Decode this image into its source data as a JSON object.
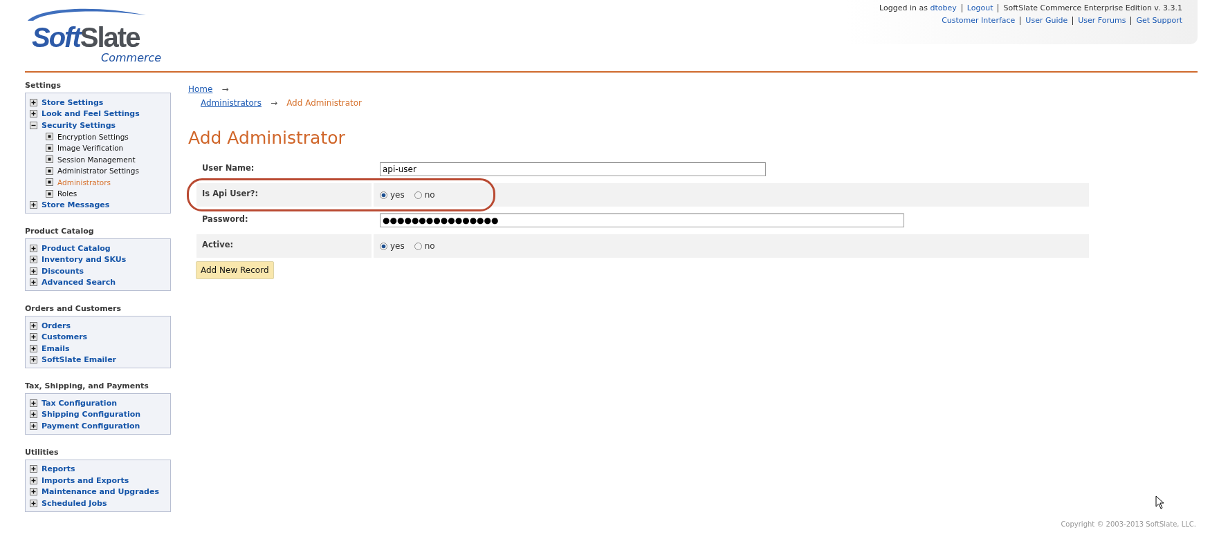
{
  "logo": {
    "wordmark": "**Soft**Slate",
    "tagline": "Commerce"
  },
  "header": {
    "login_prefix": "Logged in as",
    "user": "dtobey",
    "logout": "Logout",
    "edition": "SoftSlate Commerce Enterprise Edition v. 3.3.1",
    "links": [
      "Customer Interface",
      "User Guide",
      "User Forums",
      "Get Support"
    ]
  },
  "sidebar": [
    {
      "heading": "Settings",
      "items": [
        {
          "label": "Store Settings",
          "expanded": false
        },
        {
          "label": "Look and Feel Settings",
          "expanded": false
        },
        {
          "label": "Security Settings",
          "expanded": true,
          "children": [
            {
              "label": "Encryption Settings",
              "selected": false
            },
            {
              "label": "Image Verification",
              "selected": false
            },
            {
              "label": "Session Management",
              "selected": false
            },
            {
              "label": "Administrator Settings",
              "selected": false
            },
            {
              "label": "Administrators",
              "selected": true
            },
            {
              "label": "Roles",
              "selected": false
            }
          ]
        },
        {
          "label": "Store Messages",
          "expanded": false
        }
      ]
    },
    {
      "heading": "Product Catalog",
      "items": [
        {
          "label": "Product Catalog",
          "expanded": false
        },
        {
          "label": "Inventory and SKUs",
          "expanded": false
        },
        {
          "label": "Discounts",
          "expanded": false
        },
        {
          "label": "Advanced Search",
          "expanded": false
        }
      ]
    },
    {
      "heading": "Orders and Customers",
      "items": [
        {
          "label": "Orders",
          "expanded": false
        },
        {
          "label": "Customers",
          "expanded": false
        },
        {
          "label": "Emails",
          "expanded": false
        },
        {
          "label": "SoftSlate Emailer",
          "expanded": false
        }
      ]
    },
    {
      "heading": "Tax, Shipping, and Payments",
      "items": [
        {
          "label": "Tax Configuration",
          "expanded": false
        },
        {
          "label": "Shipping Configuration",
          "expanded": false
        },
        {
          "label": "Payment Configuration",
          "expanded": false
        }
      ]
    },
    {
      "heading": "Utilities",
      "items": [
        {
          "label": "Reports",
          "expanded": false
        },
        {
          "label": "Imports and Exports",
          "expanded": false
        },
        {
          "label": "Maintenance and Upgrades",
          "expanded": false
        },
        {
          "label": "Scheduled Jobs",
          "expanded": false
        }
      ]
    }
  ],
  "breadcrumb": {
    "separator": "→",
    "items": [
      {
        "label": "Home",
        "kind": "link"
      },
      {
        "label": "Administrators",
        "kind": "link"
      },
      {
        "label": "Add Administrator",
        "kind": "current"
      }
    ]
  },
  "title": "Add Administrator",
  "form": {
    "fields": [
      {
        "label": "User Name:",
        "kind": "text",
        "value": "api-user",
        "highlighted": false
      },
      {
        "label": "Is Api User?:",
        "kind": "radio",
        "highlighted": true,
        "options": [
          {
            "label": "yes",
            "selected": true
          },
          {
            "label": "no",
            "selected": false
          }
        ]
      },
      {
        "label": "Password:",
        "kind": "password",
        "value": "●●●●●●●●●●●●●●●●",
        "highlighted": false
      },
      {
        "label": "Active:",
        "kind": "radio",
        "highlighted": false,
        "options": [
          {
            "label": "yes",
            "selected": true
          },
          {
            "label": "no",
            "selected": false
          }
        ]
      }
    ],
    "submit": "Add New Record"
  },
  "copyright": "Copyright © 2003-2013 SoftSlate, LLC."
}
